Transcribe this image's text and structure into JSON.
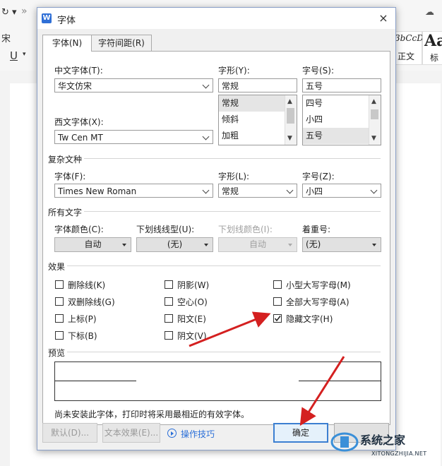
{
  "background": {
    "left_fragment_1": "宋",
    "underline_icon": "U",
    "style_sample_1": "3bCcD",
    "style_sample_1_label": "正文",
    "style_sample_2": "Aa",
    "style_sample_2_label": "标"
  },
  "dialog": {
    "title": "字体",
    "close_glyph": "×",
    "tabs": [
      {
        "label": "字体(N)",
        "active": true
      },
      {
        "label": "字符间距(R)",
        "active": false
      }
    ],
    "cn_font": {
      "label": "中文字体(T):",
      "value": "华文仿宋"
    },
    "style": {
      "label": "字形(Y):",
      "value": "常规",
      "options": [
        "常规",
        "倾斜",
        "加粗"
      ],
      "selected": "常规"
    },
    "size": {
      "label": "字号(S):",
      "value": "五号",
      "options": [
        "四号",
        "小四",
        "五号"
      ],
      "selected": "五号"
    },
    "west_font": {
      "label": "西文字体(X):",
      "value": "Tw Cen MT"
    },
    "complex": {
      "section": "复杂文种",
      "font_label": "字体(F):",
      "font_value": "Times New Roman",
      "style_label": "字形(L):",
      "style_value": "常规",
      "size_label": "字号(Z):",
      "size_value": "小四"
    },
    "all_text": {
      "section": "所有文字",
      "color_label": "字体颜色(C):",
      "color_value": "自动",
      "underline_label": "下划线线型(U):",
      "underline_value": "(无)",
      "underline_color_label": "下划线颜色(I):",
      "underline_color_value": "自动",
      "emphasis_label": "着重号:",
      "emphasis_value": "(无)"
    },
    "effects": {
      "section": "效果",
      "items": [
        {
          "label": "删除线(K)",
          "checked": false
        },
        {
          "label": "双删除线(G)",
          "checked": false
        },
        {
          "label": "上标(P)",
          "checked": false
        },
        {
          "label": "下标(B)",
          "checked": false
        },
        {
          "label": "阴影(W)",
          "checked": false
        },
        {
          "label": "空心(O)",
          "checked": false
        },
        {
          "label": "阳文(E)",
          "checked": false
        },
        {
          "label": "阴文(V)",
          "checked": false
        },
        {
          "label": "小型大写字母(M)",
          "checked": false
        },
        {
          "label": "全部大写字母(A)",
          "checked": false
        },
        {
          "label": "隐藏文字(H)",
          "checked": true
        }
      ]
    },
    "preview": {
      "section": "预览",
      "note": "尚未安装此字体，打印时将采用最相近的有效字体。"
    },
    "buttons": {
      "default": "默认(D)...",
      "text_effects": "文本效果(E)...",
      "tips": "操作技巧",
      "ok": "确定"
    }
  },
  "watermark": {
    "text": "系统之家",
    "sub": "XITONGZHIJIA.NET"
  },
  "colors": {
    "accent": "#2b6fd8",
    "arrow": "#d42020",
    "dialog_bg": "#f0f0f0"
  }
}
